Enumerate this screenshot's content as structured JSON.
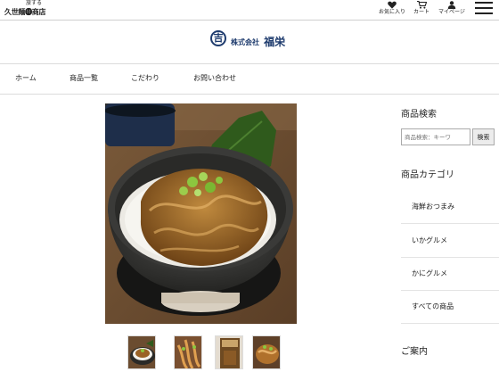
{
  "header": {
    "logo_small": "旅する",
    "logo_main": "久世麺🅜商店",
    "icons": [
      {
        "name": "heart-icon",
        "label": "お気に入り"
      },
      {
        "name": "cart-icon",
        "label": "カート"
      },
      {
        "name": "user-icon",
        "label": "マイページ"
      },
      {
        "name": "menu-icon",
        "label": ""
      }
    ]
  },
  "brand": {
    "mark": "吉",
    "name_prefix": "株式会社",
    "name_main": "福栄"
  },
  "nav": {
    "items": [
      "ホーム",
      "商品一覧",
      "こだわり",
      "お問い合わせ"
    ]
  },
  "product": {
    "main_image": "bowl-of-rice-topped-with-seasoned-squid-and-scallions",
    "thumbnails": [
      "thumbnail-1",
      "thumbnail-2",
      "thumbnail-3",
      "thumbnail-4"
    ]
  },
  "sidebar": {
    "search_heading": "商品検索",
    "search_placeholder": "商品検索：キーワ",
    "search_button": "検索",
    "category_heading": "商品カテゴリ",
    "categories": [
      "海鮮おつまみ",
      "いかグルメ",
      "かにグルメ",
      "すべての商品"
    ],
    "info_heading": "ご案内"
  },
  "colors": {
    "brand_navy": "#1f3c6e",
    "border": "#dcdcdc"
  }
}
